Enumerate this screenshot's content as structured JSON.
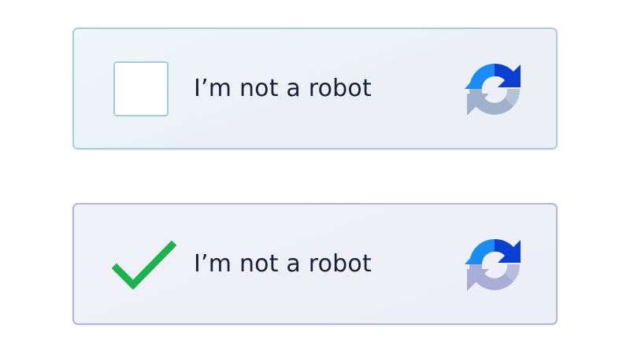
{
  "captchas": [
    {
      "state": "unchecked",
      "label": "I’m not a robot",
      "logo_icon": "recaptcha-logo-icon"
    },
    {
      "state": "checked",
      "label": "I’m not a robot",
      "logo_icon": "recaptcha-logo-icon",
      "check_color": "#1cb24c"
    }
  ],
  "colors": {
    "logo_blue_dark": "#0b3fd1",
    "logo_blue_light": "#1a8cf5",
    "logo_gray_top": "#9fb2c9",
    "logo_gray_bottom": "#a9aed6",
    "text": "#16213a"
  }
}
